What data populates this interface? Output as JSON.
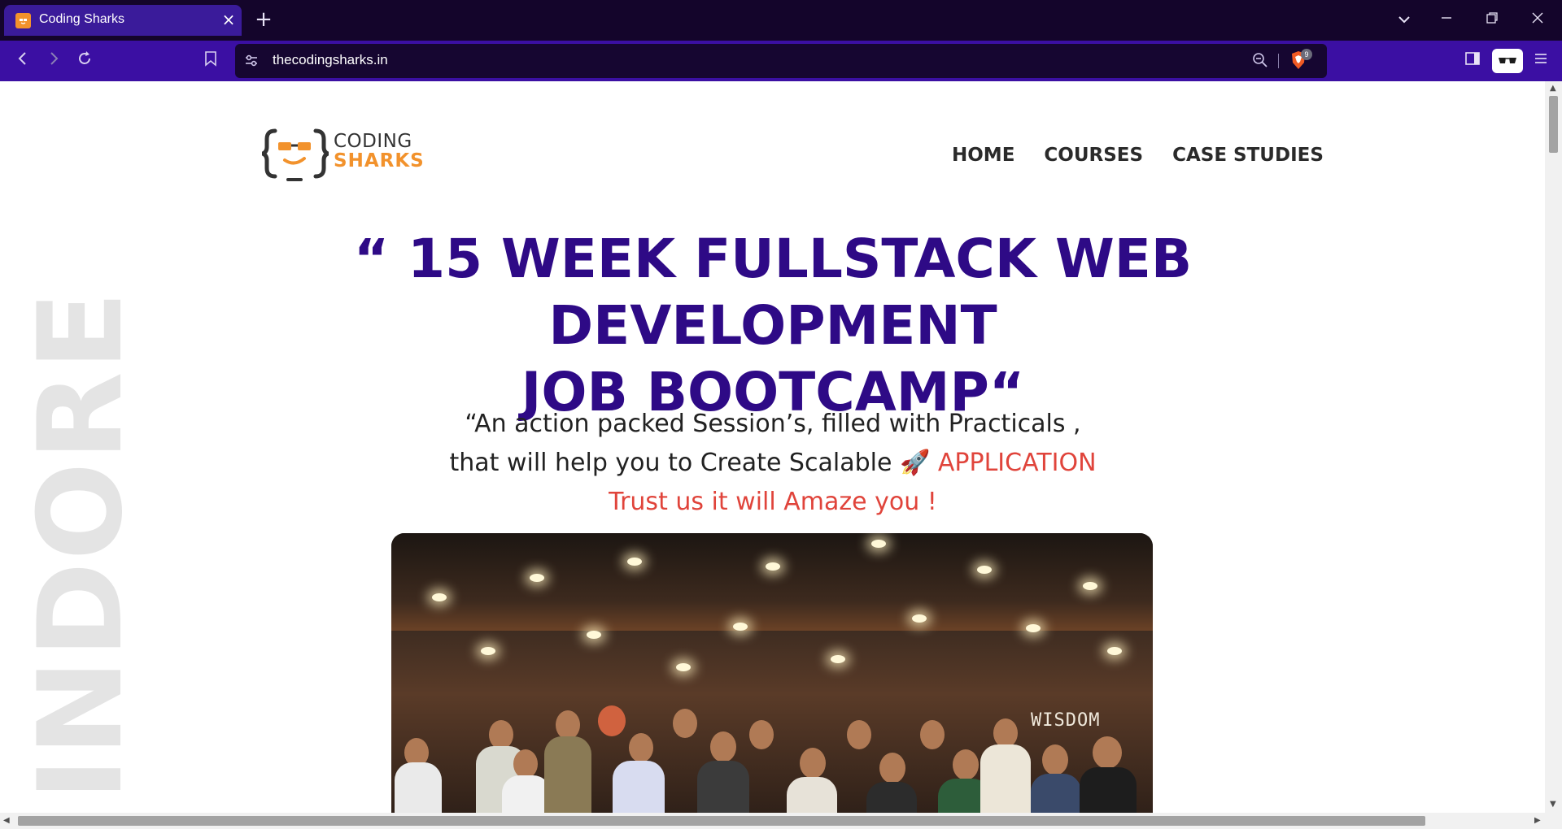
{
  "browser": {
    "tab_title": "Coding Sharks",
    "url": "thecodingsharks.in",
    "shield_count": "9"
  },
  "site": {
    "logo_line1": "CODING",
    "logo_line2": "SHARKS",
    "nav": [
      "HOME",
      "COURSES",
      "CASE STUDIES"
    ]
  },
  "hero": {
    "headline_line1": "“ 15 WEEK FULLSTACK WEB DEVELOPMENT",
    "headline_line2": "JOB BOOTCAMP“",
    "sub_line1": "“An action packed Session’s, filled with Practicals ,",
    "sub_line2_a": "that will help you to Create Scalable",
    "sub_line2_emoji": "🚀",
    "sub_line2_b": "APPLICATION",
    "sub_line3": "Trust us it will Amaze you !",
    "side_word": "INDORE",
    "photo_sign": "WISDOM"
  },
  "colors": {
    "headline": "#2e0a86",
    "accent_red": "#e0443b",
    "brand_orange": "#f2922c",
    "chrome_dark": "#14052b",
    "chrome_purple": "#3b0fa3"
  }
}
